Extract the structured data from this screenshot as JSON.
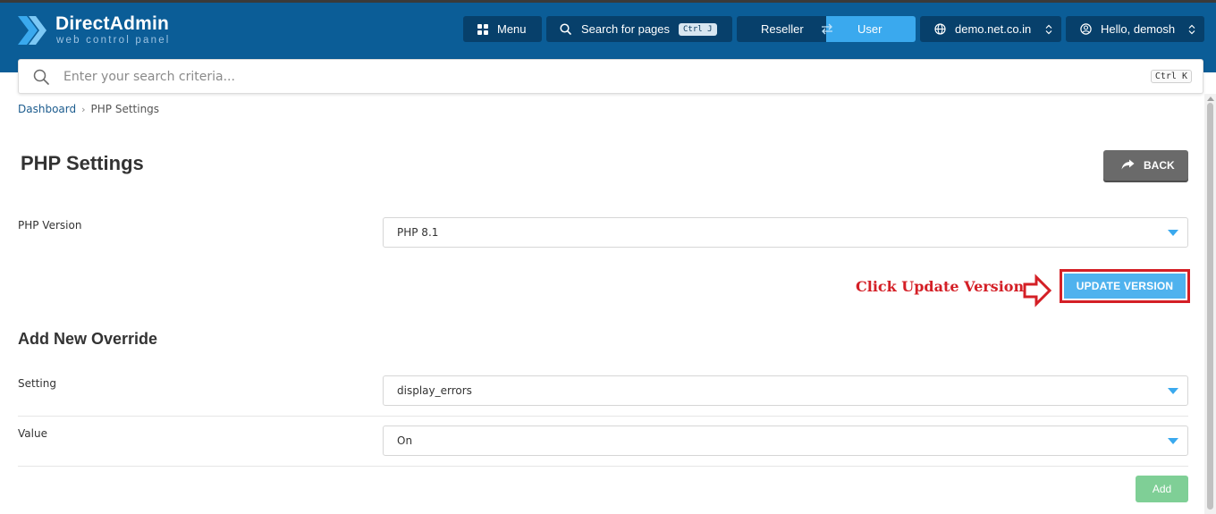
{
  "header": {
    "logo_title": "DirectAdmin",
    "logo_subtitle": "web control panel",
    "menu_label": "Menu",
    "search_label": "Search for pages",
    "search_shortcut": "Ctrl J",
    "role_reseller": "Reseller",
    "role_user": "User",
    "domain_label": "demo.net.co.in",
    "user_label": "Hello, demosh"
  },
  "search": {
    "placeholder": "Enter your search criteria...",
    "shortcut": "Ctrl K"
  },
  "breadcrumb": {
    "root": "Dashboard",
    "separator": "›",
    "current": "PHP Settings"
  },
  "page": {
    "title": "PHP Settings",
    "back_label": "BACK"
  },
  "php_version": {
    "label": "PHP Version",
    "value": "PHP 8.1",
    "update_label": "UPDATE VERSION"
  },
  "annotation": {
    "text": "Click Update Version"
  },
  "override": {
    "section_title": "Add New Override",
    "setting_label": "Setting",
    "setting_value": "display_errors",
    "value_label": "Value",
    "value_value": "On",
    "add_label": "Add"
  },
  "colors": {
    "header_bg": "#0b5d97",
    "header_button": "#07406b",
    "accent_blue": "#3aa9ee",
    "annotation_red": "#d41f26",
    "add_green": "#7fcf96"
  },
  "icons": {
    "logo": "directadmin-chevron-icon",
    "menu": "grid-icon",
    "search": "search-icon",
    "swap": "swap-arrows-icon",
    "domain": "globe-icon",
    "user": "user-circle-icon",
    "updown": "chevron-updown-icon",
    "back": "share-arrow-icon",
    "annotation": "outline-arrow-right-icon"
  }
}
